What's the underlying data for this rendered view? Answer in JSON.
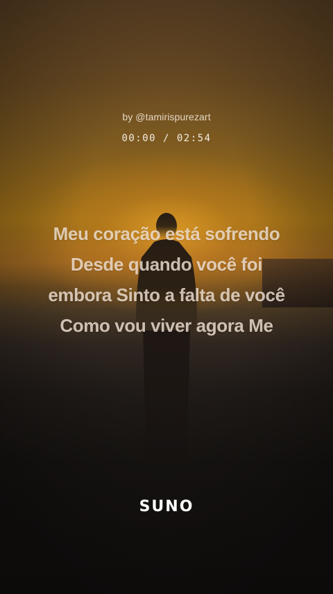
{
  "credit": "by @tamirispurezart",
  "playback": {
    "current": "00:00",
    "separator": "/",
    "duration": "02:54",
    "display": "00:00 / 02:54"
  },
  "lyrics": [
    "Meu coração está sofrendo",
    "Desde quando você foi",
    "embora Sinto a falta de você",
    "Como vou viver agora Me"
  ],
  "brand": {
    "logo_text": "SUNO"
  },
  "colors": {
    "sky_top": "#5e4326",
    "sun_glow": "#a17218",
    "ground": "#141110",
    "lyric_text": "#f0e2d4"
  }
}
